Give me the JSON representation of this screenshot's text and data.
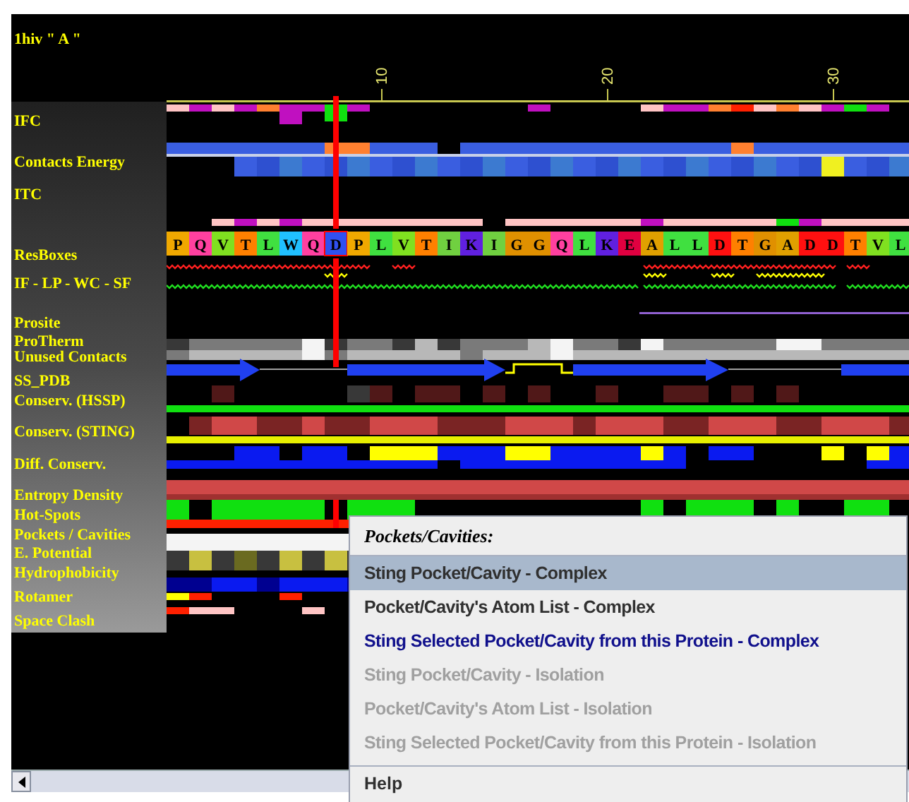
{
  "chain_title": "1hiv \" A \"",
  "ruler_ticks": [
    "10",
    "20",
    "30"
  ],
  "tracks": [
    {
      "label": "IFC"
    },
    {
      "label": "Contacts Energy"
    },
    {
      "label": "ITC"
    },
    {
      "label": "ResBoxes"
    },
    {
      "label": "IF - LP - WC - SF"
    },
    {
      "label": "Prosite"
    },
    {
      "label": "ProTherm"
    },
    {
      "label": "Unused Contacts"
    },
    {
      "label": "SS_PDB"
    },
    {
      "label": "Conserv. (HSSP)"
    },
    {
      "label": "Conserv. (STING)"
    },
    {
      "label": "Diff. Conserv."
    },
    {
      "label": "Entropy Density"
    },
    {
      "label": "Hot-Spots"
    },
    {
      "label": "Pockets / Cavities"
    },
    {
      "label": "E. Potential"
    },
    {
      "label": "Hydrophobicity"
    },
    {
      "label": "Rotamer"
    },
    {
      "label": "Space Clash"
    }
  ],
  "residues": [
    {
      "letter": "P",
      "color": "#f0a800",
      "selected": false
    },
    {
      "letter": "Q",
      "color": "#ff40a0",
      "selected": false
    },
    {
      "letter": "V",
      "color": "#80e020",
      "selected": false
    },
    {
      "letter": "T",
      "color": "#ff8000",
      "selected": false
    },
    {
      "letter": "L",
      "color": "#40e040",
      "selected": false
    },
    {
      "letter": "W",
      "color": "#20c0ff",
      "selected": false
    },
    {
      "letter": "Q",
      "color": "#ff40a0",
      "selected": false
    },
    {
      "letter": "D",
      "color": "#3050f0",
      "selected": true
    },
    {
      "letter": "P",
      "color": "#f0a800",
      "selected": false
    },
    {
      "letter": "L",
      "color": "#40e040",
      "selected": false
    },
    {
      "letter": "V",
      "color": "#80e020",
      "selected": false
    },
    {
      "letter": "T",
      "color": "#ff8000",
      "selected": false
    },
    {
      "letter": "I",
      "color": "#70d040",
      "selected": false
    },
    {
      "letter": "K",
      "color": "#6020e0",
      "selected": false
    },
    {
      "letter": "I",
      "color": "#70d040",
      "selected": false
    },
    {
      "letter": "G",
      "color": "#e09000",
      "selected": false
    },
    {
      "letter": "G",
      "color": "#e09000",
      "selected": false
    },
    {
      "letter": "Q",
      "color": "#ff40a0",
      "selected": false
    },
    {
      "letter": "L",
      "color": "#40e040",
      "selected": false
    },
    {
      "letter": "K",
      "color": "#6020e0",
      "selected": false
    },
    {
      "letter": "E",
      "color": "#e00040",
      "selected": false
    },
    {
      "letter": "A",
      "color": "#e0a000",
      "selected": false
    },
    {
      "letter": "L",
      "color": "#40e040",
      "selected": false
    },
    {
      "letter": "L",
      "color": "#40e040",
      "selected": false
    },
    {
      "letter": "D",
      "color": "#ff1010",
      "selected": false
    },
    {
      "letter": "T",
      "color": "#ff8000",
      "selected": false
    },
    {
      "letter": "G",
      "color": "#e09000",
      "selected": false
    },
    {
      "letter": "A",
      "color": "#e0a000",
      "selected": false
    },
    {
      "letter": "D",
      "color": "#ff1010",
      "selected": false
    },
    {
      "letter": "D",
      "color": "#ff1010",
      "selected": false
    },
    {
      "letter": "T",
      "color": "#ff8000",
      "selected": false
    },
    {
      "letter": "V",
      "color": "#80e020",
      "selected": false
    },
    {
      "letter": "L",
      "color": "#40e040",
      "selected": false
    }
  ],
  "popup_menu": {
    "header": "Pockets/Cavities:",
    "items": [
      {
        "label": "Sting Pocket/Cavity - Complex",
        "selected": true,
        "disabled": false,
        "emphasized": false
      },
      {
        "label": "Pocket/Cavity's Atom List - Complex",
        "selected": false,
        "disabled": false,
        "emphasized": false
      },
      {
        "label": "Sting Selected Pocket/Cavity from this Protein - Complex",
        "selected": false,
        "disabled": false,
        "emphasized": true
      },
      {
        "label": "Sting Pocket/Cavity - Isolation",
        "selected": false,
        "disabled": true,
        "emphasized": false
      },
      {
        "label": "Pocket/Cavity's Atom List - Isolation",
        "selected": false,
        "disabled": true,
        "emphasized": false
      },
      {
        "label": "Sting Selected Pocket/Cavity from this Protein - Isolation",
        "selected": false,
        "disabled": true,
        "emphasized": false
      }
    ],
    "footer_item": {
      "label": "Help"
    }
  }
}
